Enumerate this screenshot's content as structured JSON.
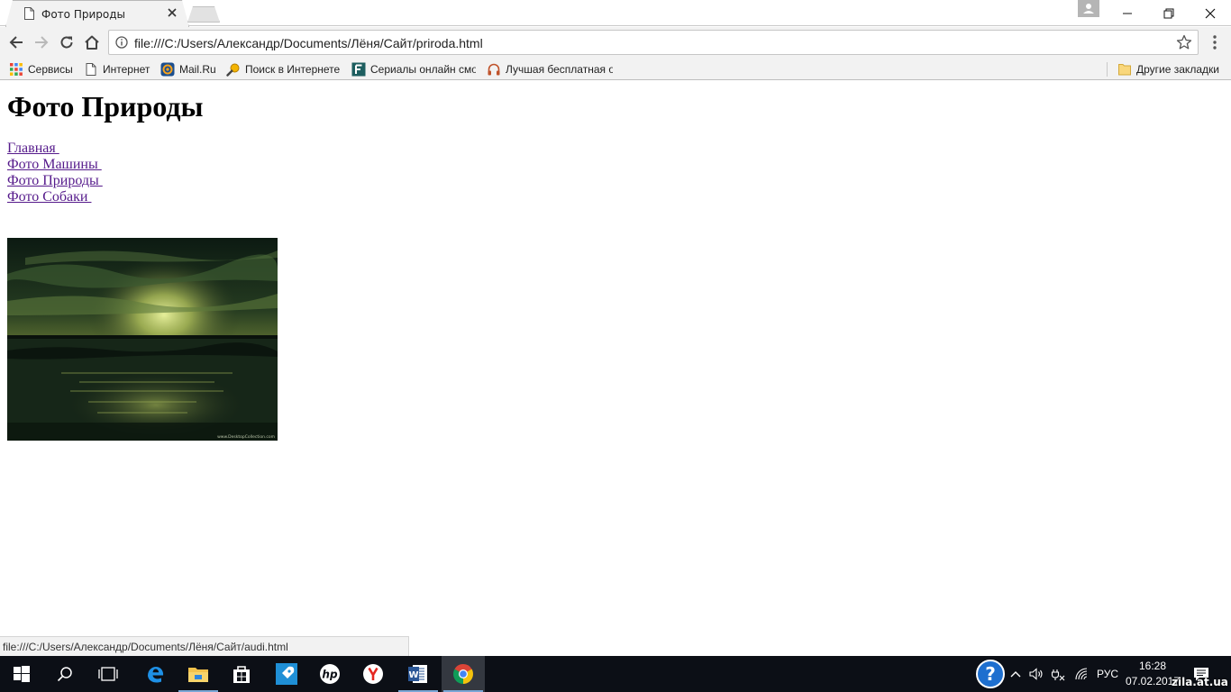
{
  "browser": {
    "tab": {
      "title": "Фото Природы",
      "favicon_icon": "page-icon",
      "close_icon": "close-icon"
    },
    "new_tab_icon": "new-tab-icon",
    "window_controls": [
      "minimize-icon",
      "restore-icon",
      "close-icon"
    ],
    "address": {
      "url": "file:///C:/Users/Александр/Documents/Лёня/Сайт/priroda.html",
      "info_icon": "info-icon",
      "bookmark_icon": "star-icon"
    },
    "nav_icons": [
      "back-arrow-icon",
      "forward-arrow-icon",
      "reload-icon",
      "home-icon"
    ],
    "bookmarks": [
      {
        "label": "Сервисы",
        "icon": "apps-grid-icon"
      },
      {
        "label": "Интернет",
        "icon": "page-icon"
      },
      {
        "label": "Mail.Ru",
        "icon": "mailru-icon"
      },
      {
        "label": "Поиск в Интернете",
        "icon": "search-icon"
      },
      {
        "label": "Сериалы онлайн смотреть",
        "icon": "f-logo-icon"
      },
      {
        "label": "Лучшая бесплатная онлайн",
        "icon": "headphones-icon"
      }
    ],
    "other_bookmarks": "Другие закладки",
    "status_url": "file:///C:/Users/Александр/Documents/Лёня/Сайт/audi.html"
  },
  "page": {
    "heading": "Фото Природы",
    "links": [
      "Главная ",
      "Фото Машины ",
      "Фото Природы ",
      "Фото Собаки "
    ],
    "link_color": "#551a8b",
    "photo": "sunset-over-sea-photo",
    "photo_caption": "www.DesktopCollection.com"
  },
  "taskbar": {
    "apps": [
      "windows-start-icon",
      "search-icon",
      "task-view-icon",
      "edge-icon",
      "file-explorer-icon",
      "store-icon",
      "rocket-app-icon",
      "hp-icon",
      "yandex-icon",
      "word-icon",
      "chrome-icon"
    ],
    "tray": {
      "help_icon": "help-icon",
      "language": "РУС"
    },
    "clock": {
      "time": "16:28",
      "date": "07.02.2017"
    },
    "accent": "#7aa7d6"
  },
  "watermark": "zila.at.ua"
}
